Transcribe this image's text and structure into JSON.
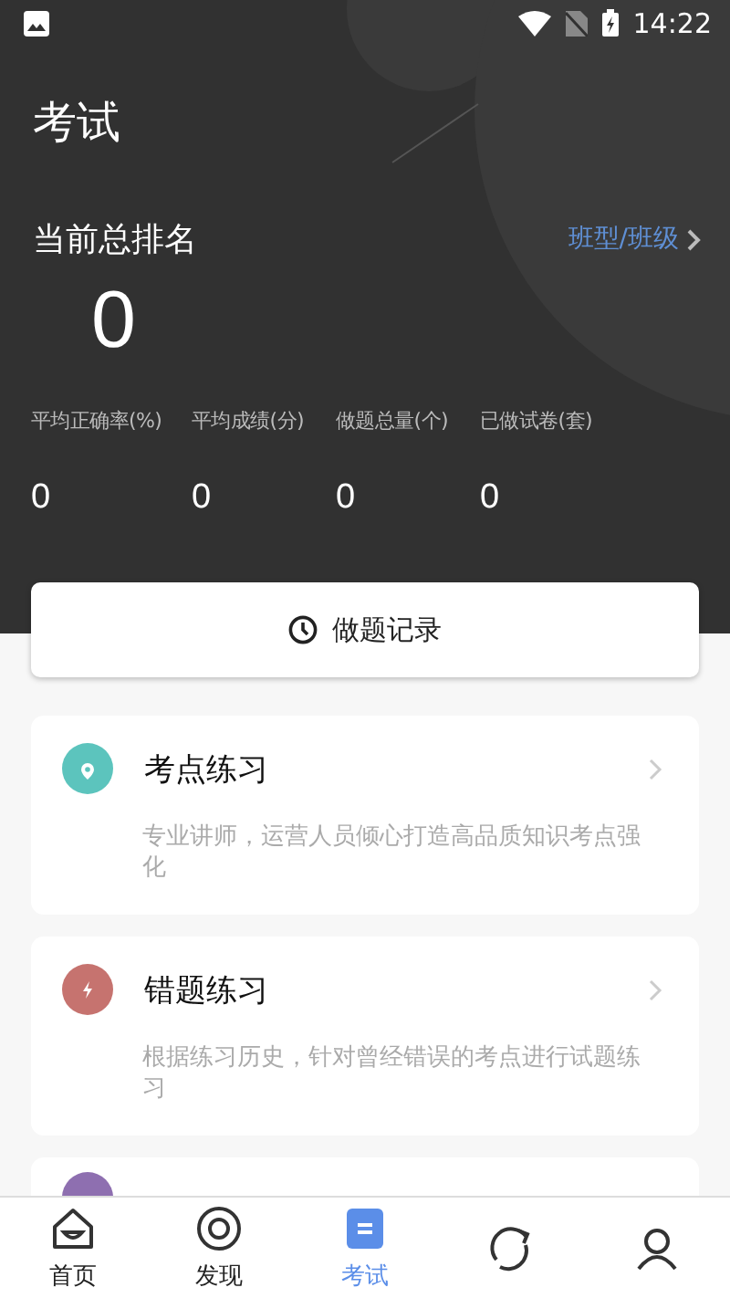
{
  "status_bar": {
    "time": "14:22"
  },
  "header": {
    "title": "考试",
    "rank_label": "当前总排名",
    "class_link": "班型/班级",
    "rank": "0"
  },
  "stats": [
    {
      "label": "平均正确率(%)",
      "value": "0"
    },
    {
      "label": "平均成绩(分)",
      "value": "0"
    },
    {
      "label": "做题总量(个)",
      "value": "0"
    },
    {
      "label": "已做试卷(套)",
      "value": "0"
    }
  ],
  "record_button": {
    "label": "做题记录"
  },
  "cards": [
    {
      "title": "考点练习",
      "description": "专业讲师，运营人员倾心打造高品质知识考点强化",
      "color": "#5cc4bd"
    },
    {
      "title": "错题练习",
      "description": "根据练习历史，针对曾经错误的考点进行试题练习",
      "color": "#c6736f"
    },
    {
      "color": "#8e6fb0"
    }
  ],
  "tabs": [
    {
      "label": "首页",
      "selected": false
    },
    {
      "label": "发现",
      "selected": false
    },
    {
      "label": "考试",
      "selected": true
    },
    {
      "selected": false
    },
    {
      "selected": false
    }
  ]
}
